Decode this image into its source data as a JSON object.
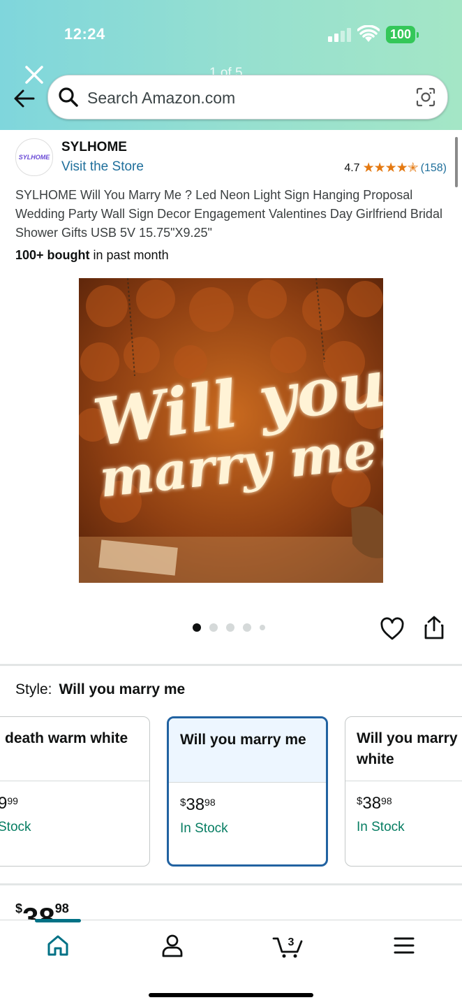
{
  "status_bar": {
    "time": "12:24",
    "battery": "100"
  },
  "viewer": {
    "page_count": "1 of 5"
  },
  "search": {
    "placeholder": "Search Amazon.com"
  },
  "store": {
    "logo_text": "SYLHOME",
    "name": "SYLHOME",
    "visit_label": "Visit the Store"
  },
  "rating": {
    "value": "4.7",
    "stars": 4.7,
    "count": "(158)"
  },
  "product": {
    "title": "SYLHOME Will You Marry Me ? Led Neon Light Sign Hanging Proposal Wedding Party Wall Sign Decor Engagement Valentines Day Girlfriend Bridal Shower Gifts USB 5V 15.75\"X9.25\"",
    "bought_bold": "100+ bought",
    "bought_rest": " in past month",
    "image_text_line1": "Will you",
    "image_text_line2": "marry me?"
  },
  "style": {
    "label": "Style:",
    "selected": "Will you marry me",
    "options": [
      {
        "name": "death warm white",
        "price_whole": "9",
        "price_fraction": "99",
        "stock": "Stock",
        "currency": ""
      },
      {
        "name": "Will you marry me",
        "price_whole": "38",
        "price_fraction": "98",
        "stock": "In Stock",
        "currency": "$"
      },
      {
        "name": "Will you marry white",
        "price_whole": "38",
        "price_fraction": "98",
        "stock": "In Stock",
        "currency": "$"
      }
    ]
  },
  "price_partial": {
    "currency": "$",
    "whole": "38",
    "fraction": "98"
  },
  "colors": {
    "accent_link": "#1f6f9b",
    "in_stock": "#067d62",
    "selected_border": "#2162a1",
    "star": "#e47911"
  },
  "icons": [
    "close-icon",
    "back-arrow-icon",
    "search-icon",
    "camera-scan-icon",
    "heart-icon",
    "share-icon",
    "home-icon",
    "account-icon",
    "cart-icon",
    "menu-icon"
  ],
  "tabbar": {
    "cart_count": "3"
  }
}
